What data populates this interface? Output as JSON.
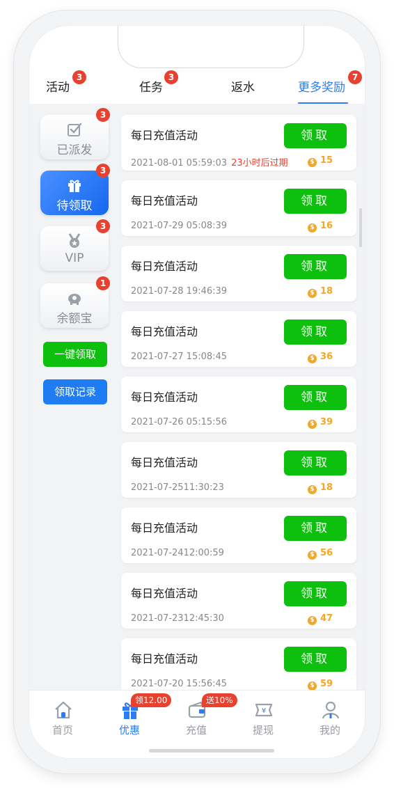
{
  "tabs": [
    {
      "label": "活动",
      "badge": "3"
    },
    {
      "label": "任务",
      "badge": "3"
    },
    {
      "label": "返水",
      "badge": ""
    },
    {
      "label": "更多奖励",
      "badge": "7",
      "active": true
    }
  ],
  "sidebar": {
    "items": [
      {
        "label": "已派发",
        "badge": "3",
        "icon": "checkbox-icon"
      },
      {
        "label": "待领取",
        "badge": "3",
        "icon": "gift-icon",
        "active": true
      },
      {
        "label": "VIP",
        "badge": "3",
        "icon": "medal-icon"
      },
      {
        "label": "余额宝",
        "badge": "1",
        "icon": "piggy-bank-icon"
      }
    ],
    "claim_all_label": "一键领取",
    "history_label": "领取记录"
  },
  "rewards": [
    {
      "title": "每日充值活动",
      "date": "2021-08-01 05:59:03",
      "expire": "23小时后过期",
      "amount": "15",
      "button": "领取"
    },
    {
      "title": "每日充值活动",
      "date": "2021-07-29 05:08:39",
      "expire": "",
      "amount": "16",
      "button": "领取"
    },
    {
      "title": "每日充值活动",
      "date": "2021-07-28 19:46:39",
      "expire": "",
      "amount": "18",
      "button": "领取"
    },
    {
      "title": "每日充值活动",
      "date": "2021-07-27 15:08:45",
      "expire": "",
      "amount": "36",
      "button": "领取"
    },
    {
      "title": "每日充值活动",
      "date": "2021-07-26 05:15:56",
      "expire": "",
      "amount": "39",
      "button": "领取"
    },
    {
      "title": "每日充值活动",
      "date": "2021-07-2511:30:23",
      "expire": "",
      "amount": "18",
      "button": "领取"
    },
    {
      "title": "每日充值活动",
      "date": "2021-07-2412:00:59",
      "expire": "",
      "amount": "56",
      "button": "领取"
    },
    {
      "title": "每日充值活动",
      "date": "2021-07-2312:45:30",
      "expire": "",
      "amount": "47",
      "button": "领取"
    },
    {
      "title": "每日充值活动",
      "date": "2021-07-20 15:56:45",
      "expire": "",
      "amount": "59",
      "button": "领取"
    }
  ],
  "bottom_nav": [
    {
      "label": "首页",
      "icon": "home-icon"
    },
    {
      "label": "优惠",
      "icon": "gift-icon",
      "active": true,
      "promo": "领12.00"
    },
    {
      "label": "充值",
      "icon": "wallet-icon",
      "promo": "送10%"
    },
    {
      "label": "提现",
      "icon": "withdraw-icon"
    },
    {
      "label": "我的",
      "icon": "user-icon"
    }
  ],
  "colors": {
    "accent": "#2d7cf6",
    "green": "#0ec00e",
    "badge": "#e8412f",
    "coin": "#f5a623"
  }
}
